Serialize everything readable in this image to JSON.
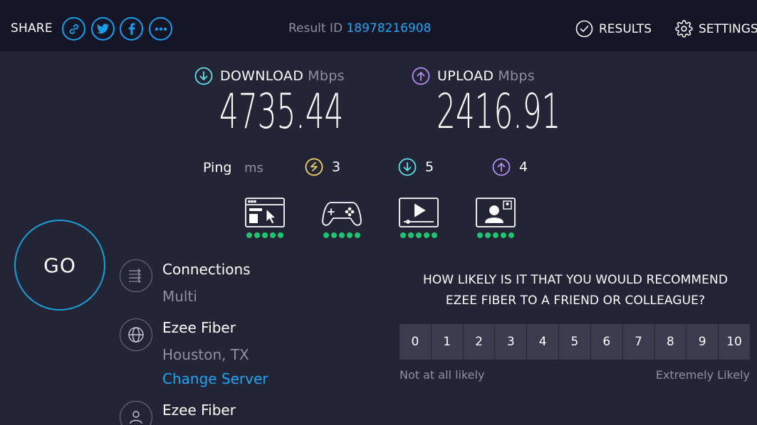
{
  "header": {
    "share_label": "SHARE",
    "share_icons": [
      "link-icon",
      "twitter-icon",
      "facebook-icon",
      "more-icon"
    ],
    "result_label": "Result ID",
    "result_id": "18978216908",
    "results_label": "RESULTS",
    "settings_label": "SETTINGS"
  },
  "download": {
    "label": "DOWNLOAD",
    "unit": "Mbps",
    "value": "4735.44"
  },
  "upload": {
    "label": "UPLOAD",
    "unit": "Mbps",
    "value": "2416.91"
  },
  "ping": {
    "label": "Ping",
    "unit": "ms",
    "idle": "3",
    "download": "5",
    "upload": "4"
  },
  "usecases": [
    {
      "icon": "web-browsing-icon",
      "rating": 5
    },
    {
      "icon": "gaming-icon",
      "rating": 5
    },
    {
      "icon": "video-streaming-icon",
      "rating": 5
    },
    {
      "icon": "video-chat-icon",
      "rating": 5
    }
  ],
  "go_label": "GO",
  "connections": {
    "title": "Connections",
    "value": "Multi"
  },
  "server": {
    "title": "Ezee Fiber",
    "location": "Houston, TX",
    "change_label": "Change Server"
  },
  "provider": {
    "title": "Ezee Fiber"
  },
  "survey": {
    "question_line1": "HOW LIKELY IS IT THAT YOU WOULD RECOMMEND",
    "question_line2": "EZEE FIBER TO A FRIEND OR COLLEAGUE?",
    "options": [
      "0",
      "1",
      "2",
      "3",
      "4",
      "5",
      "6",
      "7",
      "8",
      "9",
      "10"
    ],
    "low_label": "Not at all likely",
    "high_label": "Extremely Likely"
  },
  "colors": {
    "background": "#232435",
    "topbar": "#141526",
    "accent_blue": "#1fa6f5",
    "download_cyan": "#5ce1e6",
    "upload_purple": "#b68cf6",
    "ping_yellow": "#f3d56b",
    "rating_green": "#1ec76f"
  }
}
